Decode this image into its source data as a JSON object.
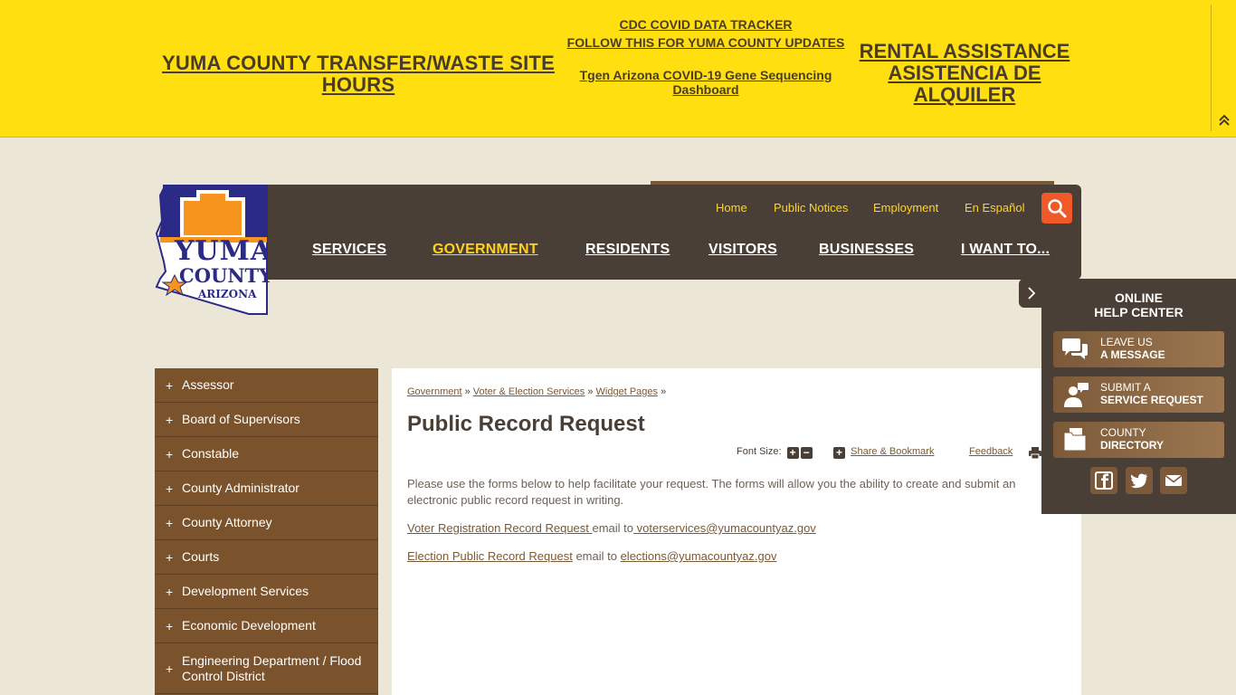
{
  "alerts": {
    "left": "YUMA COUNTY TRANSFER/WASTE SITE HOURS",
    "mid_1_line_1": "CDC COVID DATA TRACKER",
    "mid_1_line_2": "FOLLOW THIS FOR YUMA COUNTY UPDATES",
    "mid_2": "Tgen Arizona COVID-19 Gene Sequencing Dashboard",
    "right": "RENTAL ASSISTANCE ASISTENCIA DE ALQUILER",
    "collapse_icon": "chevron-double-up-icon"
  },
  "logo": {
    "line1": "YUMA",
    "line2": "COUNTY",
    "line3": "ARIZONA"
  },
  "utility_nav": [
    "Home",
    "Public Notices",
    "Employment",
    "En Español"
  ],
  "main_nav": [
    "SERVICES",
    "GOVERNMENT",
    "RESIDENTS",
    "VISITORS",
    "BUSINESSES",
    "I WANT TO..."
  ],
  "main_nav_active": "GOVERNMENT",
  "sidebar": [
    "Assessor",
    "Board of Supervisors",
    "Constable",
    "County Administrator",
    "County Attorney",
    "Courts",
    "Development Services",
    "Economic Development",
    "Engineering Department / Flood Control District"
  ],
  "breadcrumb": [
    "Government",
    "Voter & Election Services",
    "Widget Pages"
  ],
  "breadcrumb_sep": "»",
  "page_title": "Public Record Request",
  "tools": {
    "font_size_label": "Font Size:",
    "share_label": "Share & Bookmark",
    "feedback_label": "Feedback"
  },
  "body": {
    "intro": "Please use the forms below to help facilitate your request. The forms will allow you the ability to create and submit an electronic public record request in writing.",
    "voter_link": "Voter Registration Record Request ",
    "voter_email_prefix": "email to",
    "voter_email": " voterservices@yumacountyaz.gov",
    "election_link": "Election Public Record Request",
    "election_email_prefix": " email to ",
    "election_email": "elections@yumacountyaz.gov"
  },
  "help_center": {
    "title_line1": "ONLINE",
    "title_line2": "HELP CENTER",
    "buttons": [
      {
        "top": "LEAVE US",
        "bottom": "A MESSAGE",
        "icon": "chat-bubbles-icon"
      },
      {
        "top": "SUBMIT A",
        "bottom": "SERVICE REQUEST",
        "icon": "person-speech-icon"
      },
      {
        "top": "COUNTY",
        "bottom": "DIRECTORY",
        "icon": "folder-icon"
      }
    ],
    "social": [
      "facebook-icon",
      "twitter-icon",
      "mail-icon"
    ]
  },
  "colors": {
    "alert_bg": "#ffdf0f",
    "nav_bg": "#4a3f36",
    "nav_active": "#ffd21f",
    "sidebar_bg": "#7a532d",
    "search_bg": "#f05a28",
    "page_bg": "#ebe6d6"
  }
}
